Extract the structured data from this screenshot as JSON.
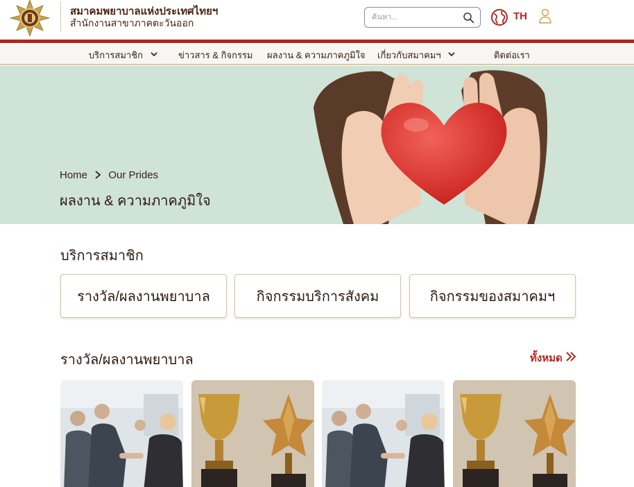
{
  "header": {
    "org_name": "สมาคมพยาบาลแห่งประเทศไทยฯ",
    "org_branch": "สำนักงานสาขาภาคตะวันออก",
    "search_placeholder": "ค้นหา...",
    "language": "TH"
  },
  "nav": {
    "items": [
      {
        "label": "บริการสมาชิก",
        "has_dropdown": true
      },
      {
        "label": "ข่าวสาร & กิจกรรม",
        "has_dropdown": false
      },
      {
        "label": "ผลงาน & ความภาคภูมิใจ",
        "has_dropdown": false
      },
      {
        "label": "เกี่ยวกับสมาคมฯ",
        "has_dropdown": true
      },
      {
        "label": "ติดต่อเรา",
        "has_dropdown": false
      }
    ]
  },
  "hero": {
    "breadcrumb_home": "Home",
    "breadcrumb_current": "Our Prides",
    "title": "ผลงาน & ความภาคภูมิใจ"
  },
  "section": {
    "title": "บริการสมาชิก",
    "categories": [
      "รางวัล/ผลงานพยาบาล",
      "กิจกรรมบริการสังคม",
      "กิจกรรมของสมาคมฯ"
    ]
  },
  "awards": {
    "title": "รางวัล/ผลงานพยาบาล",
    "see_all": "ทั้งหมด",
    "cards": [
      {
        "image": "handshake-photo"
      },
      {
        "image": "trophy-photo"
      },
      {
        "image": "handshake-photo"
      },
      {
        "image": "trophy-photo"
      }
    ]
  },
  "colors": {
    "brand_red": "#b3261e",
    "hero_green": "#cfe3d6",
    "gold": "#d9c49a",
    "text_dark": "#2a1a12"
  }
}
